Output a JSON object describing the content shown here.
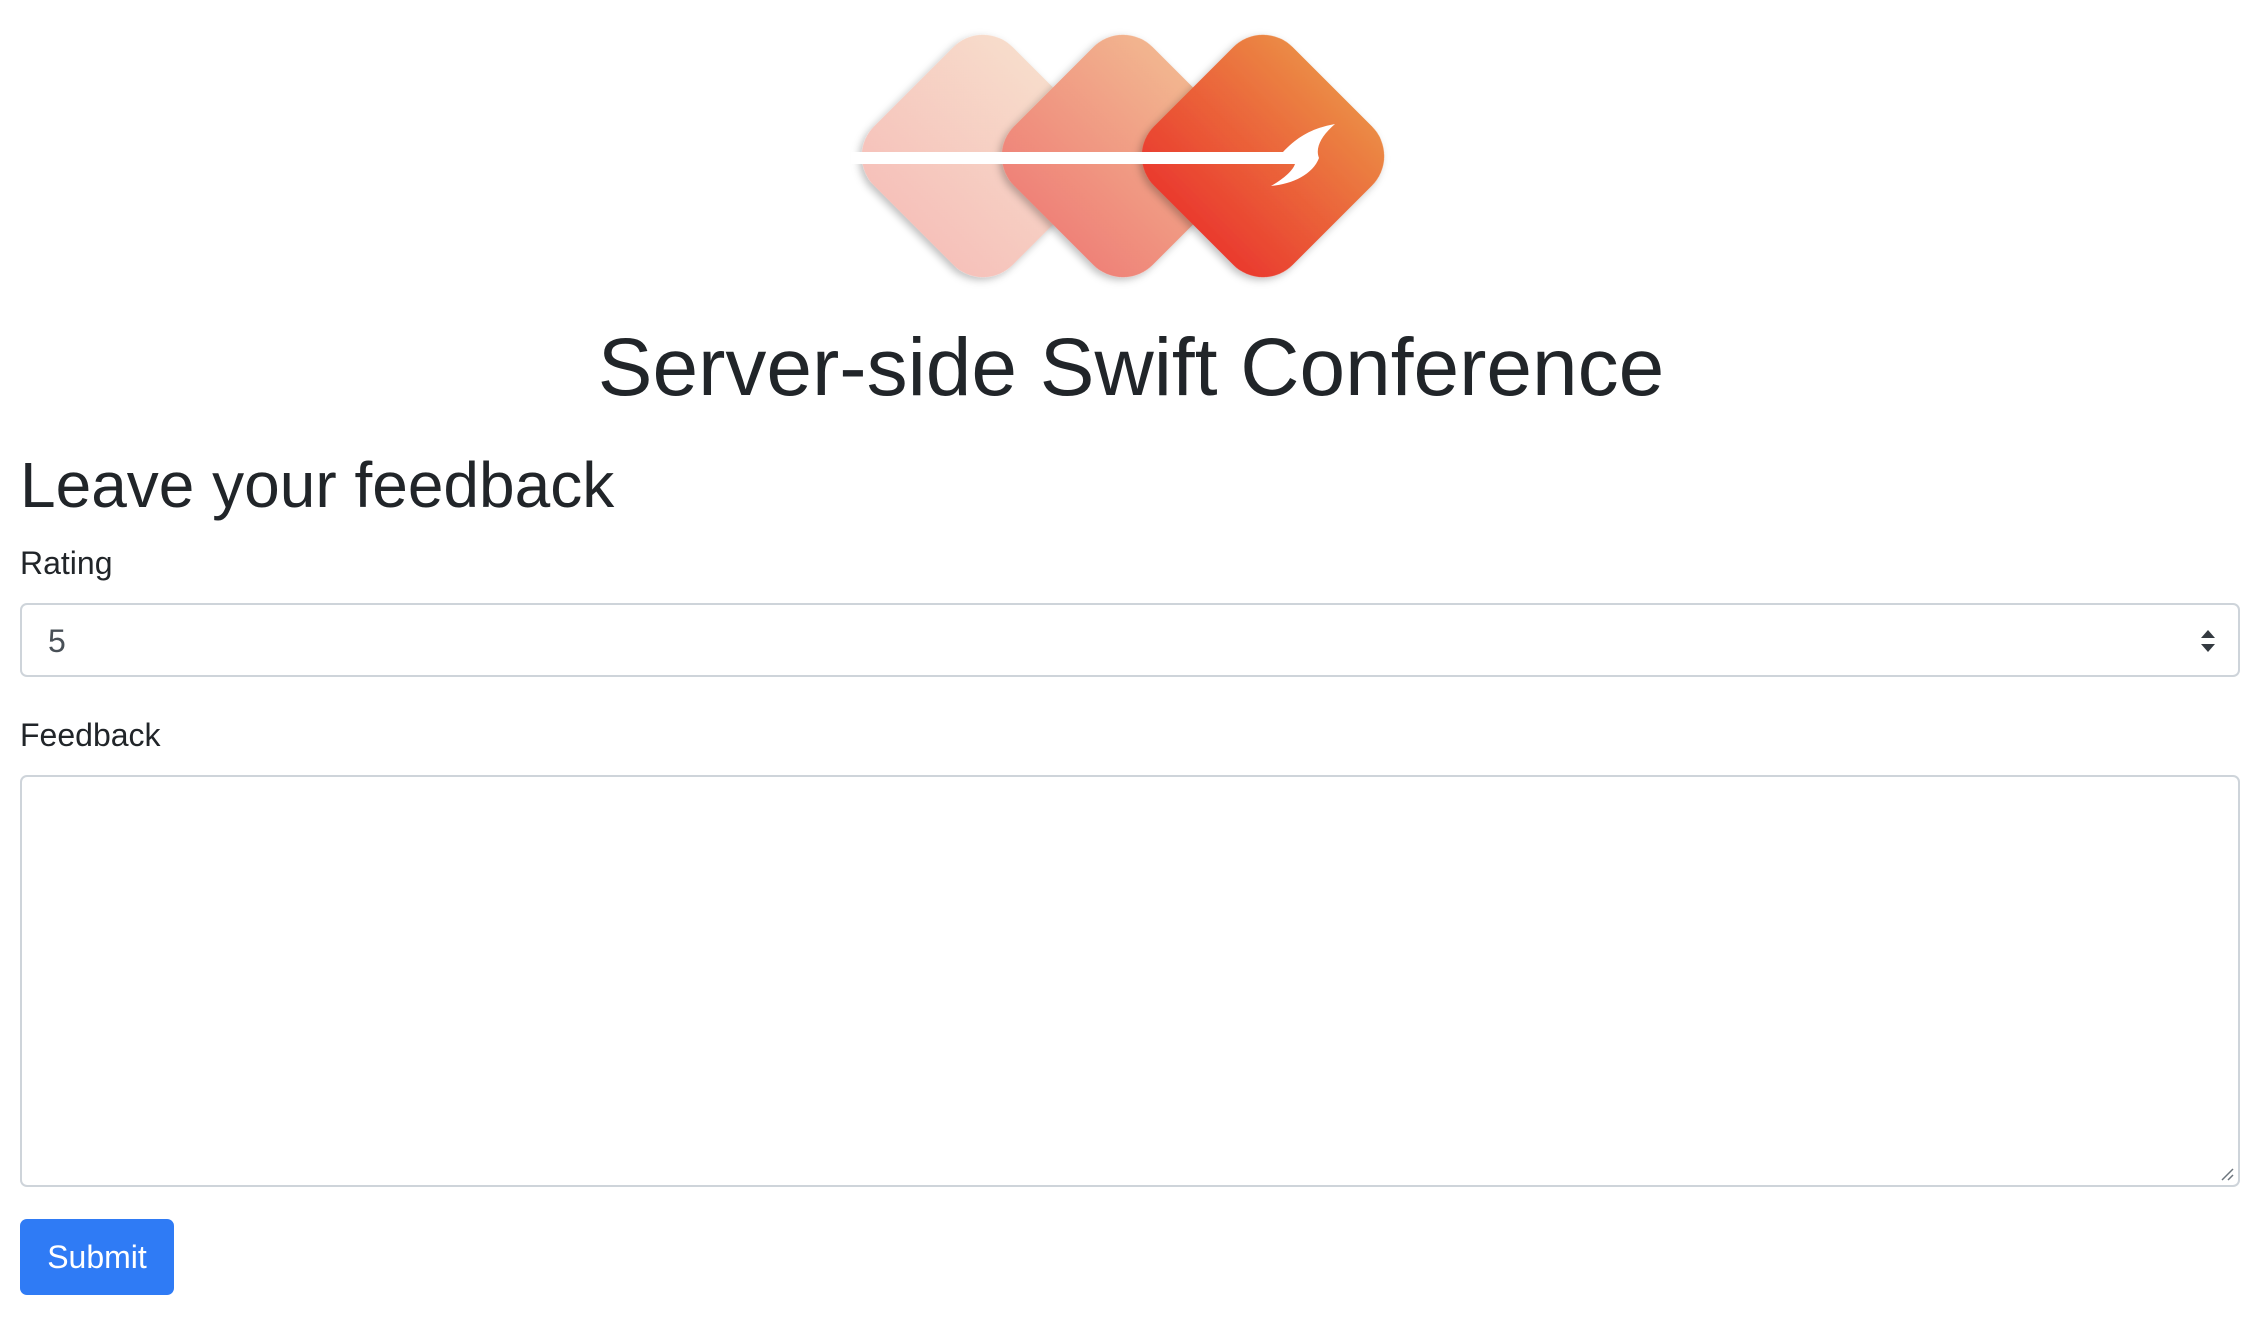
{
  "header": {
    "logo_icon": "swift-conference-logo-icon",
    "title": "Server-side Swift Conference"
  },
  "form": {
    "heading": "Leave your feedback",
    "rating": {
      "label": "Rating",
      "selected_value": "5",
      "arrow_icon": "select-updown-icon"
    },
    "feedback": {
      "label": "Feedback",
      "value": ""
    },
    "submit_label": "Submit"
  },
  "colors": {
    "text": "#212529",
    "input_border": "#ced4da",
    "primary_button": "#2f7bf5",
    "logo_light": "#f8cfc0",
    "logo_mid": "#f08e7c",
    "logo_dark": "#eb4a35"
  }
}
